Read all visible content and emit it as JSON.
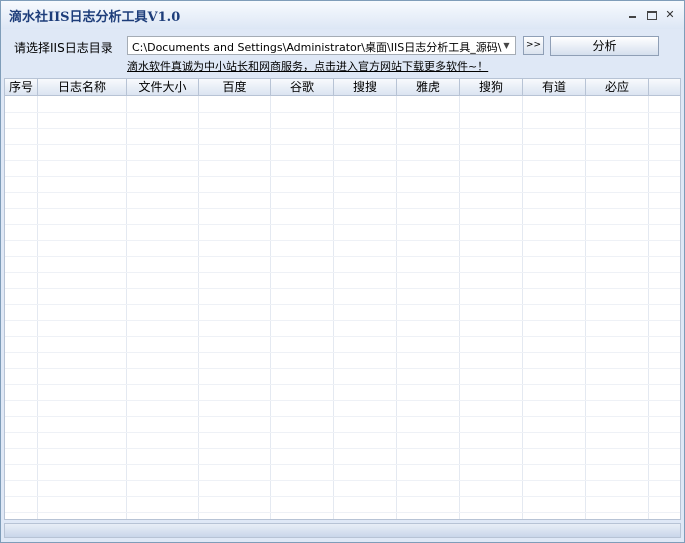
{
  "window": {
    "title": "滴水社IIS日志分析工具V1.0",
    "min_glyph": "",
    "close_glyph": "✕"
  },
  "toolbar": {
    "dir_label": "请选择IIS日志目录",
    "path_value": "C:\\Documents and Settings\\Administrator\\桌面\\IIS日志分析工具_源码\\",
    "dropdown_icon": "chevron-down-icon",
    "browse_label": ">>",
    "analyze_label": "分析",
    "promo_link": "滴水软件真诚为中小站长和网商服务，点击进入官方网站下载更多软件~！"
  },
  "table": {
    "columns": [
      "序号",
      "日志名称",
      "文件大小",
      "百度",
      "谷歌",
      "搜搜",
      "雅虎",
      "搜狗",
      "有道",
      "必应"
    ],
    "rows": []
  },
  "colors": {
    "title_text": "#1d3d7a",
    "window_bg": "#dfe8f6",
    "border": "#7f9db9"
  }
}
